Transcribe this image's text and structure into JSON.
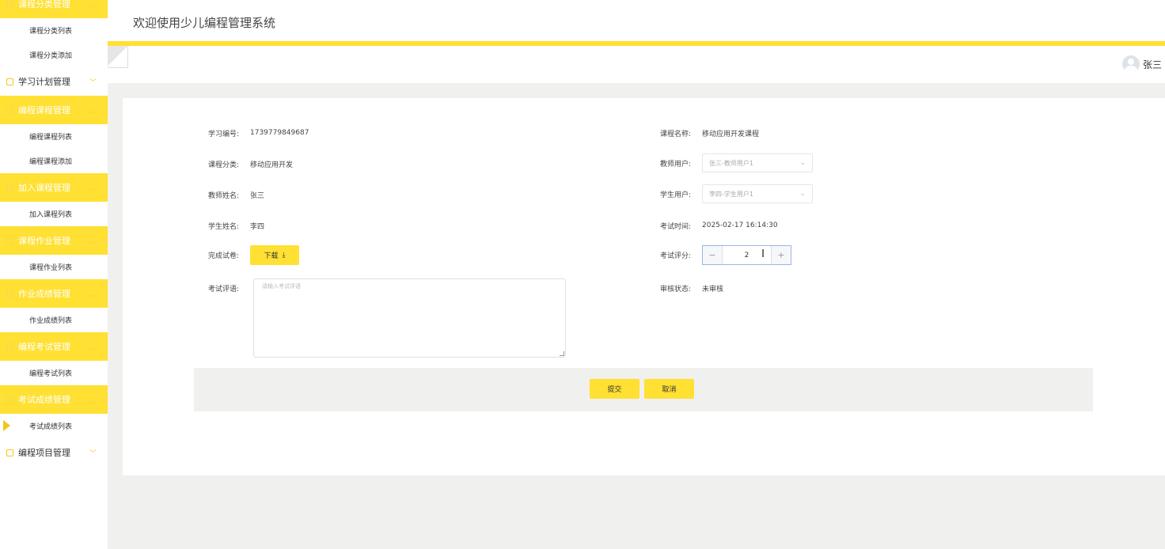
{
  "app": {
    "title": "欢迎使用少儿编程管理系统"
  },
  "user": {
    "name": "张三"
  },
  "sidebar": {
    "groups": [
      {
        "label": "课程分类管理",
        "state": "active",
        "items": [
          "课程分类列表",
          "课程分类添加"
        ]
      },
      {
        "label": "学习计划管理",
        "state": "closed",
        "items": []
      },
      {
        "label": "编程课程管理",
        "state": "active",
        "items": [
          "编程课程列表",
          "编程课程添加"
        ]
      },
      {
        "label": "加入课程管理",
        "state": "active",
        "items": [
          "加入课程列表"
        ]
      },
      {
        "label": "课程作业管理",
        "state": "active",
        "items": [
          "课程作业列表"
        ]
      },
      {
        "label": "作业成绩管理",
        "state": "active",
        "items": [
          "作业成绩列表"
        ]
      },
      {
        "label": "编程考试管理",
        "state": "active",
        "items": [
          "编程考试列表"
        ]
      },
      {
        "label": "考试成绩管理",
        "state": "active",
        "items": [
          "考试成绩列表"
        ]
      },
      {
        "label": "编程项目管理",
        "state": "closed",
        "items": []
      }
    ]
  },
  "form": {
    "study_no": {
      "label": "学习编号:",
      "value": "1739779849687"
    },
    "course_name": {
      "label": "课程名称:",
      "value": "移动应用开发课程"
    },
    "course_category": {
      "label": "课程分类:",
      "value": "移动应用开发"
    },
    "teacher_user": {
      "label": "教师用户:",
      "value": "张三-教师用户1"
    },
    "teacher_name": {
      "label": "教师姓名:",
      "value": "张三"
    },
    "student_user": {
      "label": "学生用户:",
      "value": "李四-学生用户1"
    },
    "student_name": {
      "label": "学生姓名:",
      "value": "李四"
    },
    "exam_time": {
      "label": "考试时间:",
      "value": "2025-02-17 16:14:30"
    },
    "finished_paper": {
      "label": "完成试卷:",
      "button": "下载"
    },
    "exam_score": {
      "label": "考试评分:",
      "value": "2",
      "minus": "−",
      "plus": "+"
    },
    "exam_comment": {
      "label": "考试评语:",
      "placeholder": "请输入考试评语"
    },
    "review_status": {
      "label": "审核状态:",
      "value": "未审核"
    }
  },
  "actions": {
    "submit": "提交",
    "cancel": "取消"
  },
  "colors": {
    "accent": "#ffe033",
    "background": "#f0f0ee"
  }
}
